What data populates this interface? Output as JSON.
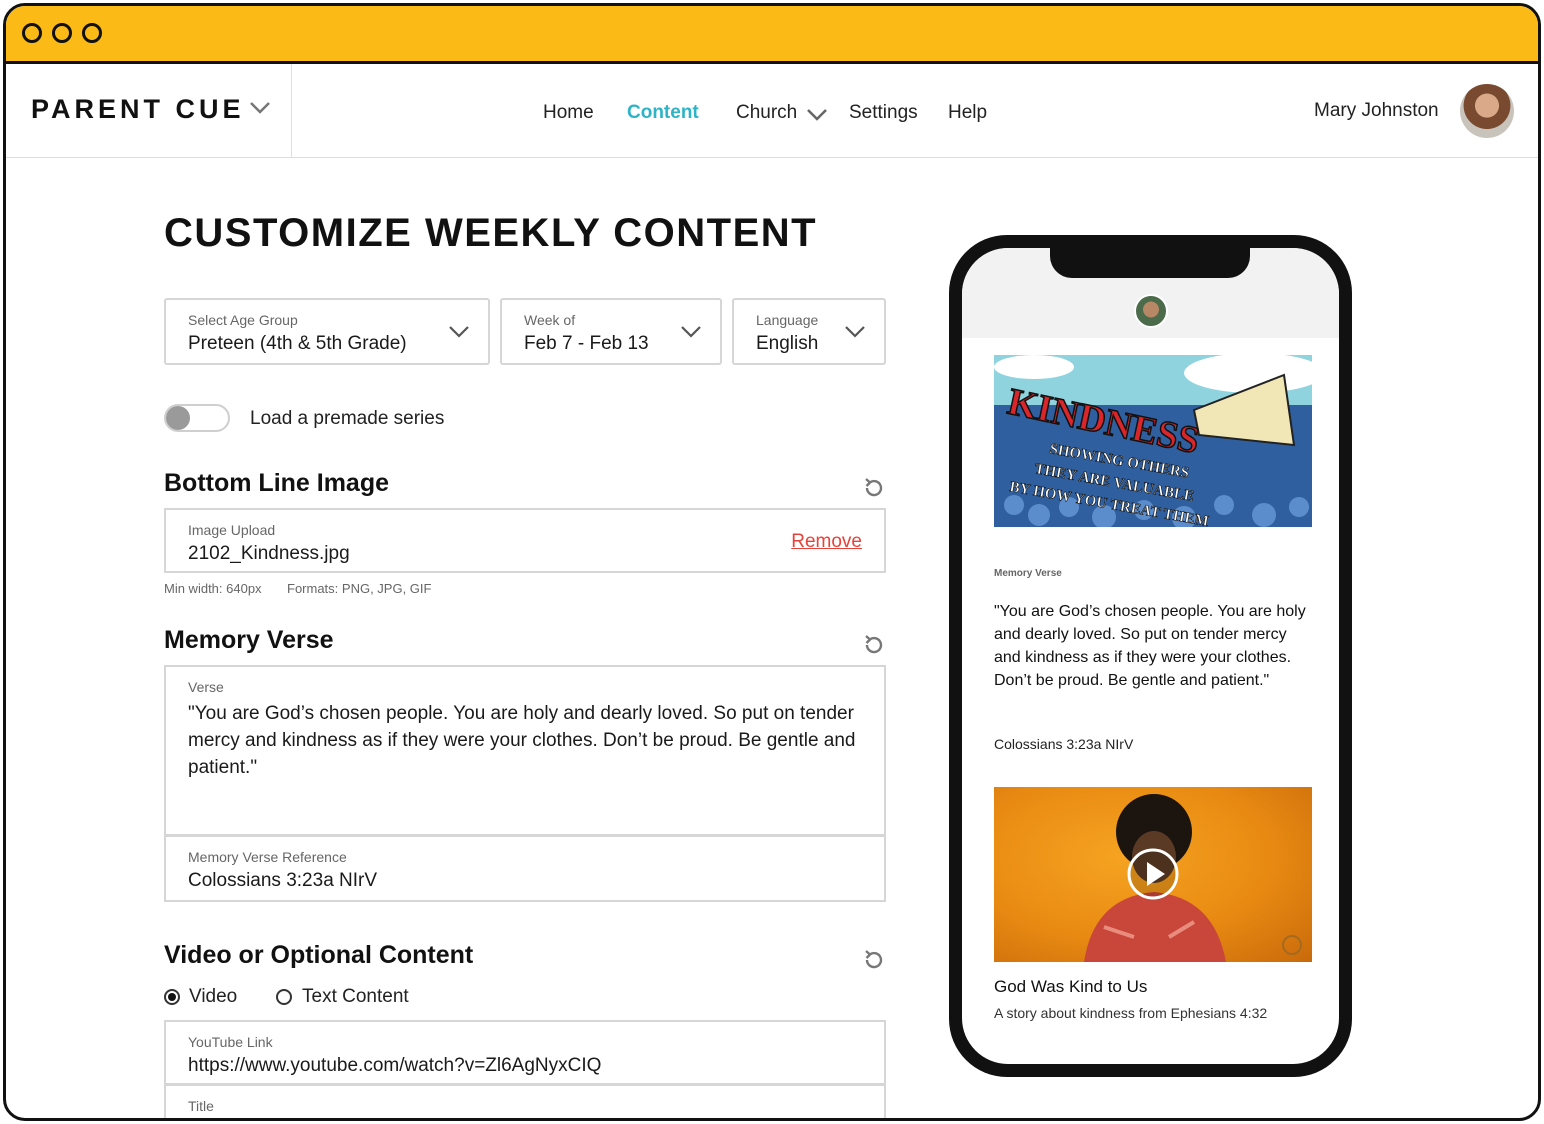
{
  "window": {
    "controls": [
      "window-dot",
      "window-dot",
      "window-dot"
    ]
  },
  "brand": {
    "name": "PARENT CUE"
  },
  "nav": {
    "items": [
      {
        "label": "Home"
      },
      {
        "label": "Content"
      },
      {
        "label": "Church"
      },
      {
        "label": "Settings"
      },
      {
        "label": "Help"
      }
    ],
    "active": "Content",
    "accent_color": "#2EB4C6"
  },
  "user": {
    "name": "Mary Johnston"
  },
  "page": {
    "title": "CUSTOMIZE WEEKLY CONTENT"
  },
  "filters": {
    "age_group": {
      "label": "Select Age Group",
      "value": "Preteen (4th & 5th Grade)"
    },
    "week": {
      "label": "Week of",
      "value": "Feb 7 - Feb 13"
    },
    "language": {
      "label": "Language",
      "value": "English"
    }
  },
  "premade": {
    "label": "Load a premade series",
    "enabled": false
  },
  "bottom_line": {
    "title": "Bottom Line Image",
    "upload_label": "Image Upload",
    "file_name": "2102_Kindness.jpg",
    "remove_label": "Remove",
    "hint_width": "Min width: 640px",
    "hint_formats": "Formats: PNG, JPG, GIF"
  },
  "memory_verse": {
    "title": "Memory Verse",
    "verse_label": "Verse",
    "verse_text": "\"You are God’s chosen people. You are holy and dearly loved. So put on tender mercy and kindness as if they were your clothes. Don’t be proud. Be gentle and patient.\"",
    "reference_label": "Memory Verse Reference",
    "reference_value": "Colossians 3:23a NIrV"
  },
  "video_section": {
    "title": "Video or Optional Content",
    "option_video": "Video",
    "option_text": "Text Content",
    "selected": "Video",
    "youtube_label": "YouTube Link",
    "youtube_value": "https://www.youtube.com/watch?v=Zl6AgNyxCIQ",
    "title_label": "Title"
  },
  "preview": {
    "banner_headline": "KINDNESS",
    "banner_lines": [
      "SHOWING OTHERS",
      "THEY ARE VALUABLE",
      "BY HOW YOU TREAT THEM"
    ],
    "memory_label": "Memory Verse",
    "verse_text": "\"You are God’s chosen people. You are holy and dearly loved. So put on tender mercy and kindness as if they were your clothes. Don’t be proud. Be gentle and patient.\"",
    "reference": "Colossians 3:23a NIrV",
    "video_title": "God Was Kind to Us",
    "video_subtitle": "A story about kindness from Ephesians 4:32"
  },
  "colors": {
    "titlebar": "#FBBA16",
    "remove": "#e8413a"
  }
}
